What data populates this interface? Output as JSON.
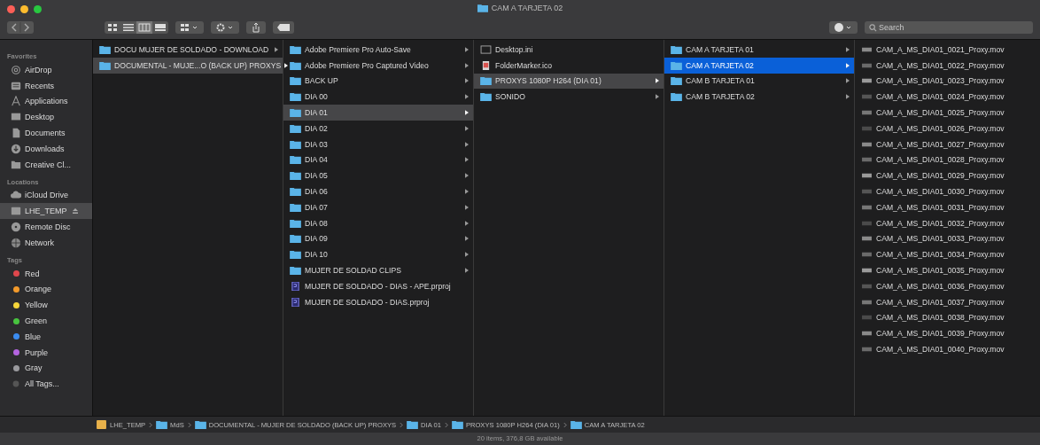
{
  "window": {
    "title": "CAM A TARJETA 02"
  },
  "toolbar": {
    "view_modes": [
      {
        "kind": "icons",
        "selected": false
      },
      {
        "kind": "list",
        "selected": false
      },
      {
        "kind": "columns",
        "selected": true
      },
      {
        "kind": "gallery",
        "selected": false
      }
    ],
    "search": {
      "placeholder": "Search"
    }
  },
  "sidebar": [
    {
      "heading": "Favorites",
      "items": [
        {
          "label": "AirDrop",
          "kind": "airdrop",
          "selected": false
        },
        {
          "label": "Recents",
          "kind": "recents",
          "selected": false
        },
        {
          "label": "Applications",
          "kind": "apps",
          "selected": false
        },
        {
          "label": "Desktop",
          "kind": "desktop",
          "selected": false
        },
        {
          "label": "Documents",
          "kind": "documents",
          "selected": false
        },
        {
          "label": "Downloads",
          "kind": "downloads",
          "selected": false
        },
        {
          "label": "Creative Cl...",
          "kind": "folder",
          "selected": false
        }
      ]
    },
    {
      "heading": "Locations",
      "items": [
        {
          "label": "iCloud Drive",
          "kind": "cloud",
          "selected": false
        },
        {
          "label": "LHE_TEMP",
          "kind": "disk",
          "selected": true,
          "eject": true
        },
        {
          "label": "Remote Disc",
          "kind": "disc",
          "selected": false
        },
        {
          "label": "Network",
          "kind": "network",
          "selected": false
        }
      ]
    },
    {
      "heading": "Tags",
      "items": [
        {
          "label": "Red",
          "kind": "tag",
          "color": "#e0474c",
          "selected": false
        },
        {
          "label": "Orange",
          "kind": "tag",
          "color": "#f39a2b",
          "selected": false
        },
        {
          "label": "Yellow",
          "kind": "tag",
          "color": "#f5d53a",
          "selected": false
        },
        {
          "label": "Green",
          "kind": "tag",
          "color": "#48c43f",
          "selected": false
        },
        {
          "label": "Blue",
          "kind": "tag",
          "color": "#3b8cf0",
          "selected": false
        },
        {
          "label": "Purple",
          "kind": "tag",
          "color": "#b464e0",
          "selected": false
        },
        {
          "label": "Gray",
          "kind": "tag",
          "color": "#9a9a9e",
          "selected": false
        },
        {
          "label": "All Tags...",
          "kind": "alltags",
          "selected": false
        }
      ]
    }
  ],
  "columns": [
    {
      "items": [
        {
          "name": "DOCU MUJER DE SOLDADO - DOWNLOAD",
          "kind": "folder",
          "has_children": true,
          "selected": false,
          "expanded": false
        },
        {
          "name": "DOCUMENTAL - MUJE...O (BACK UP) PROXYS",
          "kind": "folder",
          "has_children": true,
          "selected": false,
          "expanded": true
        }
      ]
    },
    {
      "items": [
        {
          "name": "Adobe Premiere Pro Auto-Save",
          "kind": "folder",
          "has_children": true,
          "selected": false,
          "expanded": false
        },
        {
          "name": "Adobe Premiere Pro Captured Video",
          "kind": "folder",
          "has_children": true,
          "selected": false,
          "expanded": false
        },
        {
          "name": "BACK UP",
          "kind": "folder",
          "has_children": true,
          "selected": false,
          "expanded": false
        },
        {
          "name": "DIA 00",
          "kind": "folder",
          "has_children": true,
          "selected": false,
          "expanded": false
        },
        {
          "name": "DIA 01",
          "kind": "folder",
          "has_children": true,
          "selected": false,
          "expanded": true
        },
        {
          "name": "DIA 02",
          "kind": "folder",
          "has_children": true,
          "selected": false,
          "expanded": false
        },
        {
          "name": "DIA 03",
          "kind": "folder",
          "has_children": true,
          "selected": false,
          "expanded": false
        },
        {
          "name": "DIA 04",
          "kind": "folder",
          "has_children": true,
          "selected": false,
          "expanded": false
        },
        {
          "name": "DIA 05",
          "kind": "folder",
          "has_children": true,
          "selected": false,
          "expanded": false
        },
        {
          "name": "DIA 06",
          "kind": "folder",
          "has_children": true,
          "selected": false,
          "expanded": false
        },
        {
          "name": "DIA 07",
          "kind": "folder",
          "has_children": true,
          "selected": false,
          "expanded": false
        },
        {
          "name": "DIA 08",
          "kind": "folder",
          "has_children": true,
          "selected": false,
          "expanded": false
        },
        {
          "name": "DIA 09",
          "kind": "folder",
          "has_children": true,
          "selected": false,
          "expanded": false
        },
        {
          "name": "DIA 10",
          "kind": "folder",
          "has_children": true,
          "selected": false,
          "expanded": false
        },
        {
          "name": "MUJER DE SOLDAD CLIPS",
          "kind": "folder",
          "has_children": true,
          "selected": false,
          "expanded": false
        },
        {
          "name": "MUJER DE SOLDADO - DIAS - APE.prproj",
          "kind": "project",
          "has_children": false,
          "selected": false,
          "expanded": false
        },
        {
          "name": "MUJER DE SOLDADO - DIAS.prproj",
          "kind": "project",
          "has_children": false,
          "selected": false,
          "expanded": false
        }
      ]
    },
    {
      "items": [
        {
          "name": "Desktop.ini",
          "kind": "document",
          "has_children": false,
          "selected": false,
          "expanded": false
        },
        {
          "name": "FolderMarker.ico",
          "kind": "image",
          "has_children": false,
          "selected": false,
          "expanded": false
        },
        {
          "name": "PROXYS 1080P H264 (DIA 01)",
          "kind": "folder",
          "has_children": true,
          "selected": false,
          "expanded": true
        },
        {
          "name": "SONIDO",
          "kind": "folder",
          "has_children": true,
          "selected": false,
          "expanded": false
        }
      ]
    },
    {
      "items": [
        {
          "name": "CAM A TARJETA 01",
          "kind": "folder",
          "has_children": true,
          "selected": false,
          "expanded": false
        },
        {
          "name": "CAM A TARJETA 02",
          "kind": "folder",
          "has_children": true,
          "selected": true,
          "expanded": true
        },
        {
          "name": "CAM B TARJETA 01",
          "kind": "folder",
          "has_children": true,
          "selected": false,
          "expanded": false
        },
        {
          "name": "CAM B TARJETA 02",
          "kind": "folder",
          "has_children": true,
          "selected": false,
          "expanded": false
        }
      ]
    },
    {
      "items": [
        {
          "name": "CAM_A_MS_DIA01_0021_Proxy.mov",
          "kind": "video",
          "has_children": false,
          "selected": false,
          "expanded": false
        },
        {
          "name": "CAM_A_MS_DIA01_0022_Proxy.mov",
          "kind": "video",
          "has_children": false,
          "selected": false,
          "expanded": false
        },
        {
          "name": "CAM_A_MS_DIA01_0023_Proxy.mov",
          "kind": "video",
          "has_children": false,
          "selected": false,
          "expanded": false
        },
        {
          "name": "CAM_A_MS_DIA01_0024_Proxy.mov",
          "kind": "video",
          "has_children": false,
          "selected": false,
          "expanded": false
        },
        {
          "name": "CAM_A_MS_DIA01_0025_Proxy.mov",
          "kind": "video",
          "has_children": false,
          "selected": false,
          "expanded": false
        },
        {
          "name": "CAM_A_MS_DIA01_0026_Proxy.mov",
          "kind": "video",
          "has_children": false,
          "selected": false,
          "expanded": false
        },
        {
          "name": "CAM_A_MS_DIA01_0027_Proxy.mov",
          "kind": "video",
          "has_children": false,
          "selected": false,
          "expanded": false
        },
        {
          "name": "CAM_A_MS_DIA01_0028_Proxy.mov",
          "kind": "video",
          "has_children": false,
          "selected": false,
          "expanded": false
        },
        {
          "name": "CAM_A_MS_DIA01_0029_Proxy.mov",
          "kind": "video",
          "has_children": false,
          "selected": false,
          "expanded": false
        },
        {
          "name": "CAM_A_MS_DIA01_0030_Proxy.mov",
          "kind": "video",
          "has_children": false,
          "selected": false,
          "expanded": false
        },
        {
          "name": "CAM_A_MS_DIA01_0031_Proxy.mov",
          "kind": "video",
          "has_children": false,
          "selected": false,
          "expanded": false
        },
        {
          "name": "CAM_A_MS_DIA01_0032_Proxy.mov",
          "kind": "video",
          "has_children": false,
          "selected": false,
          "expanded": false
        },
        {
          "name": "CAM_A_MS_DIA01_0033_Proxy.mov",
          "kind": "video",
          "has_children": false,
          "selected": false,
          "expanded": false
        },
        {
          "name": "CAM_A_MS_DIA01_0034_Proxy.mov",
          "kind": "video",
          "has_children": false,
          "selected": false,
          "expanded": false
        },
        {
          "name": "CAM_A_MS_DIA01_0035_Proxy.mov",
          "kind": "video",
          "has_children": false,
          "selected": false,
          "expanded": false
        },
        {
          "name": "CAM_A_MS_DIA01_0036_Proxy.mov",
          "kind": "video",
          "has_children": false,
          "selected": false,
          "expanded": false
        },
        {
          "name": "CAM_A_MS_DIA01_0037_Proxy.mov",
          "kind": "video",
          "has_children": false,
          "selected": false,
          "expanded": false
        },
        {
          "name": "CAM_A_MS_DIA01_0038_Proxy.mov",
          "kind": "video",
          "has_children": false,
          "selected": false,
          "expanded": false
        },
        {
          "name": "CAM_A_MS_DIA01_0039_Proxy.mov",
          "kind": "video",
          "has_children": false,
          "selected": false,
          "expanded": false
        },
        {
          "name": "CAM_A_MS_DIA01_0040_Proxy.mov",
          "kind": "video",
          "has_children": false,
          "selected": false,
          "expanded": false
        }
      ]
    }
  ],
  "path_bar": [
    {
      "label": "LHE_TEMP",
      "kind": "disk"
    },
    {
      "label": "MdS",
      "kind": "folder"
    },
    {
      "label": "DOCUMENTAL - MUJER DE SOLDADO (BACK UP) PROXYS",
      "kind": "folder"
    },
    {
      "label": "DIA 01",
      "kind": "folder"
    },
    {
      "label": "PROXYS 1080P H264 (DIA 01)",
      "kind": "folder"
    },
    {
      "label": "CAM A TARJETA 02",
      "kind": "folder"
    }
  ],
  "status_bar": "20 items, 376,8 GB available"
}
